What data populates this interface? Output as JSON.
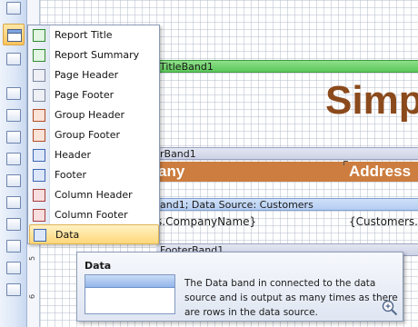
{
  "menu": {
    "items": [
      {
        "label": "Report Title",
        "icon": "report-title-icon",
        "color": "#3aa53a"
      },
      {
        "label": "Report Summary",
        "icon": "report-summary-icon",
        "color": "#3aa53a"
      },
      {
        "label": "Page Header",
        "icon": "page-header-icon",
        "color": "#8e9bb8"
      },
      {
        "label": "Page Footer",
        "icon": "page-footer-icon",
        "color": "#8e9bb8"
      },
      {
        "label": "Group Header",
        "icon": "group-header-icon",
        "color": "#c65a2e"
      },
      {
        "label": "Group Footer",
        "icon": "group-footer-icon",
        "color": "#c65a2e"
      },
      {
        "label": "Header",
        "icon": "header-icon",
        "color": "#4f7fd1"
      },
      {
        "label": "Footer",
        "icon": "footer-icon",
        "color": "#4f7fd1"
      },
      {
        "label": "Column Header",
        "icon": "column-header-icon",
        "color": "#c94a4a"
      },
      {
        "label": "Column Footer",
        "icon": "column-footer-icon",
        "color": "#c94a4a"
      },
      {
        "label": "Data",
        "icon": "data-band-icon",
        "color": "#4f7fd1",
        "selected": true
      }
    ]
  },
  "canvas": {
    "title_band": "TitleBand1",
    "big_title": "Simp",
    "header_band": "rBand1",
    "col_company": "any",
    "col_address": "Address",
    "data_band": "and1; Data Source: Customers",
    "cell_company": "s.CompanyName}",
    "cell_address": "{Customers.",
    "footer_band": "FooterBand1"
  },
  "tooltip": {
    "title": "Data",
    "description": "The Data band in connected to the data source and is output as many times as there are rows in the data source."
  },
  "ruler": {
    "numbers": [
      "5",
      "6"
    ]
  },
  "colors": {
    "accent_selected": "#ffc45c",
    "title_text": "#8b4a1c",
    "header_strip": "#cc7d3f",
    "title_band": "#5cc75a",
    "data_band": "#b4cdf2"
  }
}
